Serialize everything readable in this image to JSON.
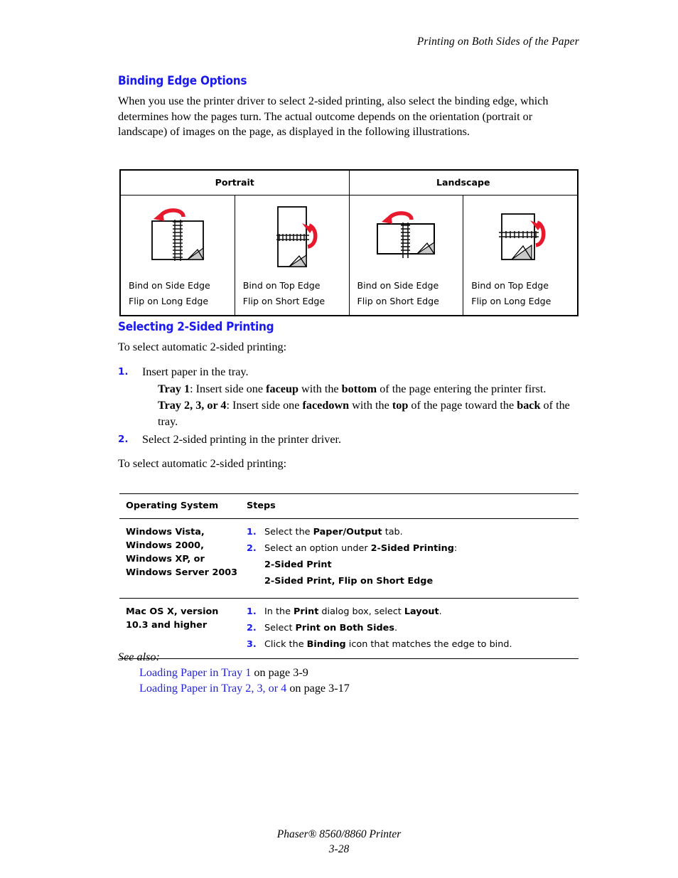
{
  "running_header": "Printing on Both Sides of the Paper",
  "section1": {
    "heading": "Binding Edge Options",
    "paragraph": "When you use the printer driver to select 2-sided printing, also select the binding edge, which determines how the pages turn. The actual outcome depends on the orientation (portrait or landscape) of images on the page, as displayed in the following illustrations."
  },
  "illustration_table": {
    "headers": [
      "Portrait",
      "Landscape"
    ],
    "cells": [
      {
        "figure": "portrait-bind-side-edge-icon",
        "line1": "Bind on Side Edge",
        "line2": "Flip on Long Edge"
      },
      {
        "figure": "portrait-bind-top-edge-icon",
        "line1": "Bind on Top Edge",
        "line2": "Flip on Short Edge"
      },
      {
        "figure": "landscape-bind-side-edge-icon",
        "line1": "Bind on Side Edge",
        "line2": "Flip on Short Edge"
      },
      {
        "figure": "landscape-bind-top-edge-icon",
        "line1": "Bind on Top Edge",
        "line2": "Flip on Long Edge"
      }
    ]
  },
  "section2": {
    "heading": "Selecting 2-Sided Printing",
    "intro": "To select automatic 2-sided printing:",
    "steps": [
      {
        "num": "1.",
        "text": "Insert paper in the tray."
      },
      {
        "num": "2.",
        "text": "Select 2-sided printing in the printer driver."
      }
    ],
    "tray1_label": "Tray 1",
    "tray1_rest_a": ": Insert side one ",
    "tray1_bold_a": "faceup",
    "tray1_rest_b": " with the ",
    "tray1_bold_b": "bottom",
    "tray1_rest_c": " of the page entering the printer first.",
    "tray234_label": "Tray 2, 3, or 4",
    "tray234_rest_a": ": Insert side one ",
    "tray234_bold_a": "facedown",
    "tray234_rest_b": " with the ",
    "tray234_bold_b": "top",
    "tray234_rest_c": " of the page toward the ",
    "tray234_bold_c": "back",
    "tray234_rest_d": " of the tray.",
    "outro": "To select automatic 2-sided printing:"
  },
  "steps_table": {
    "headers": {
      "col1": "Operating System",
      "col2": "Steps"
    },
    "rows": [
      {
        "os_lines": [
          "Windows Vista,",
          "Windows 2000,",
          "Windows XP, or",
          "Windows Server 2003"
        ],
        "steps": [
          {
            "num": "1.",
            "pre": "Select the ",
            "bold": "Paper/Output",
            "post": " tab."
          },
          {
            "num": "2.",
            "pre": "Select an option under ",
            "bold": "2-Sided Printing",
            "post": ":"
          }
        ],
        "plain_options": [
          "2-Sided Print",
          "2-Sided Print, Flip on Short Edge"
        ]
      },
      {
        "os_lines": [
          "Mac OS X, version",
          "10.3 and higher"
        ],
        "steps": [
          {
            "num": "1.",
            "pre": "In the ",
            "bold": "Print",
            "mid": " dialog box, select ",
            "bold2": "Layout",
            "post": "."
          },
          {
            "num": "2.",
            "pre": "Select ",
            "bold": "Print on Both Sides",
            "post": "."
          },
          {
            "num": "3.",
            "pre": "Click the ",
            "bold": "Binding",
            "post": " icon that matches the edge to bind."
          }
        ],
        "plain_options": []
      }
    ]
  },
  "see_also": {
    "label": "See also:",
    "links": [
      {
        "link": "Loading Paper in Tray 1",
        "suffix": " on page 3-9"
      },
      {
        "link": "Loading Paper in Tray 2, 3, or 4",
        "suffix": " on page 3-17"
      }
    ]
  },
  "footer": {
    "product": "Phaser® 8560/8860 Printer",
    "page_number": "3-28"
  },
  "colors": {
    "heading_blue": "#1a1aee",
    "link_blue": "#2222dd",
    "arrow_red": "#e8192c",
    "fold_gray": "#c9c9c9"
  }
}
